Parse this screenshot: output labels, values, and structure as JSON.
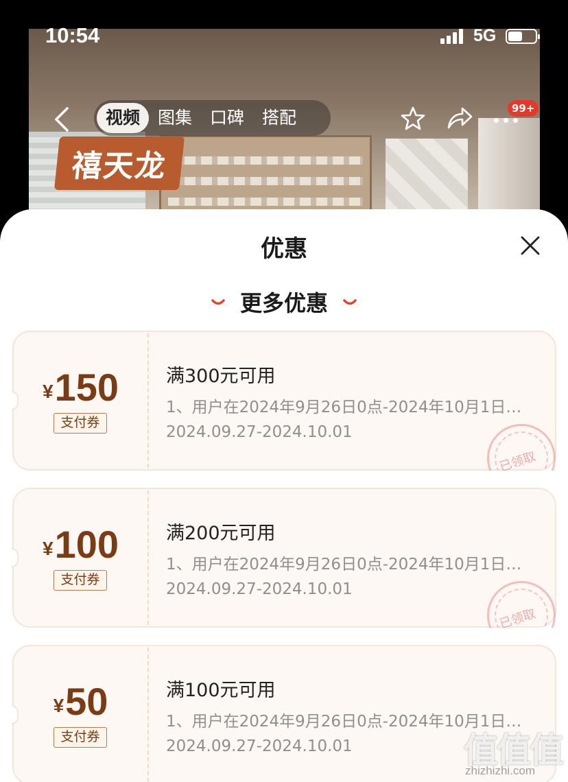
{
  "status_bar": {
    "time": "10:54",
    "network": "5G"
  },
  "header": {
    "tabs": [
      {
        "label": "视频",
        "active": true
      },
      {
        "label": "图集",
        "active": false
      },
      {
        "label": "口碑",
        "active": false
      },
      {
        "label": "搭配",
        "active": false
      }
    ],
    "cart_badge": "99+",
    "brand_logo_text": "禧天龙"
  },
  "sheet": {
    "title": "优惠",
    "section_title": "更多优惠",
    "coupons": [
      {
        "currency": "¥",
        "amount": "150",
        "type": "支付券",
        "condition": "满300元可用",
        "description": "1、用户在2024年9月26日0点-2024年10月1日…",
        "date_range": "2024.09.27-2024.10.01",
        "stamp": "已领取"
      },
      {
        "currency": "¥",
        "amount": "100",
        "type": "支付券",
        "condition": "满200元可用",
        "description": "1、用户在2024年9月26日0点-2024年10月1日…",
        "date_range": "2024.09.27-2024.10.01",
        "stamp": "已领取"
      },
      {
        "currency": "¥",
        "amount": "50",
        "type": "支付券",
        "condition": "满100元可用",
        "description": "1、用户在2024年9月26日0点-2024年10月1日…",
        "date_range": "2024.09.27-2024.10.01",
        "stamp": ""
      }
    ]
  },
  "watermark": {
    "glyphs": "值值值",
    "site": "zhizhizhi.com"
  },
  "colors": {
    "accent": "#7a3c14",
    "badge": "#e33a2c",
    "coupon_bg": "#fdf8f3"
  }
}
